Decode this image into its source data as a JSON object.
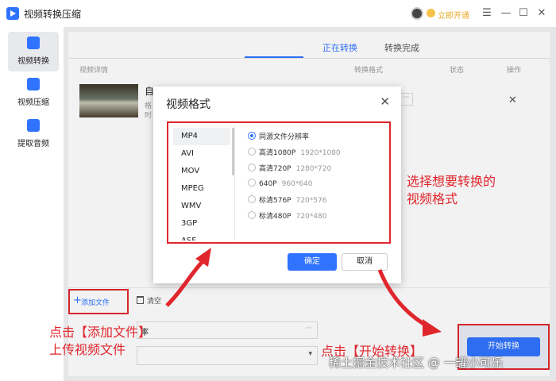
{
  "app": {
    "title": "视频转换压缩",
    "vip_link": "立即开通"
  },
  "window_controls": {
    "menu": "☰",
    "minimize": "—",
    "maximize": "☐",
    "close": "✕"
  },
  "sidebar": {
    "items": [
      {
        "label": "视频转换"
      },
      {
        "label": "视频压缩"
      },
      {
        "label": "提取音频"
      }
    ]
  },
  "tabs": [
    {
      "label": "正在转换"
    },
    {
      "label": "转换完成"
    }
  ],
  "columns": {
    "details": "视频详情",
    "format": "转换格式",
    "status": "状态",
    "action": "操作"
  },
  "row": {
    "title_partial": "自",
    "line2_partial": "格",
    "line3_partial": "时",
    "more": "···",
    "close": "✕"
  },
  "toolbar": {
    "add_label": "添加文件",
    "clear_label": "清空"
  },
  "output": {
    "field1_label": "率",
    "field1_more": "···",
    "field2_arrow": "▾"
  },
  "start_button_label": "开始转换",
  "dialog": {
    "title": "视频格式",
    "close": "✕",
    "formats": [
      "MP4",
      "AVI",
      "MOV",
      "MPEG",
      "WMV",
      "3GP",
      "ASF"
    ],
    "selected_format": "MP4",
    "resolutions": [
      {
        "label": "同源文件分辨率",
        "dim": ""
      },
      {
        "label": "高清1080P",
        "dim": "1920*1080"
      },
      {
        "label": "高清720P",
        "dim": "1280*720"
      },
      {
        "label": "640P",
        "dim": "960*640"
      },
      {
        "label": "标清576P",
        "dim": "720*576"
      },
      {
        "label": "标清480P",
        "dim": "720*480"
      }
    ],
    "selected_resolution": "同源文件分辨率",
    "ok_label": "确定",
    "cancel_label": "取消"
  },
  "annotations": {
    "choose_format_1": "选择想要转换的",
    "choose_format_2": "视频格式",
    "add_file_1": "点击【添加文件】",
    "add_file_2": "上传视频文件",
    "start": "点击【开始转换】"
  },
  "watermark": "稀土掘金技术社区 @ 一罐小可乐",
  "colors": {
    "accent": "#2f73ff",
    "annotation_red": "#e0262d",
    "vip_gold": "#e7a826"
  }
}
